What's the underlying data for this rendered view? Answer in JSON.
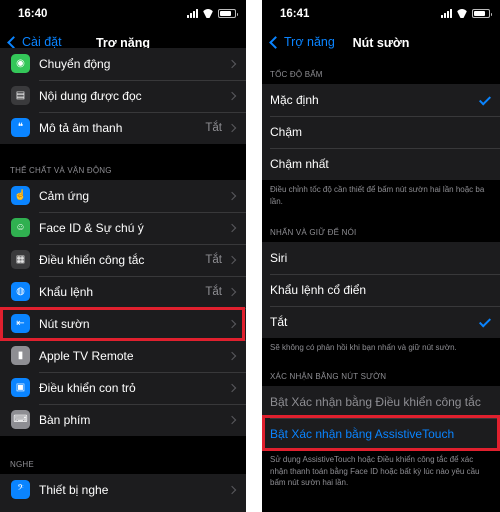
{
  "left": {
    "status": {
      "time": "16:40"
    },
    "nav": {
      "back_label": "Cài đặt",
      "title": "Trợ năng"
    },
    "top_rows": [
      {
        "label": "Chuyển động",
        "value": "",
        "icon": "motion-icon",
        "color": "#34c759"
      },
      {
        "label": "Nội dung được đọc",
        "value": "",
        "icon": "spoken-content-icon",
        "color": "#3a3a3c"
      },
      {
        "label": "Mô tả âm thanh",
        "value": "Tắt",
        "icon": "audio-descriptions-icon",
        "color": "#0a84ff"
      }
    ],
    "section_physical": "THỂ CHẤT VÀ VẬN ĐỘNG",
    "physical_rows": [
      {
        "label": "Cảm ứng",
        "value": "",
        "icon": "touch-icon",
        "color": "#0a84ff"
      },
      {
        "label": "Face ID & Sự chú ý",
        "value": "",
        "icon": "face-id-icon",
        "color": "#30b050"
      },
      {
        "label": "Điều khiển công tắc",
        "value": "Tắt",
        "icon": "switch-control-icon",
        "color": "#3a3a3c"
      },
      {
        "label": "Khẩu lệnh",
        "value": "Tắt",
        "icon": "voice-control-icon",
        "color": "#0a84ff"
      },
      {
        "label": "Nút sườn",
        "value": "",
        "icon": "side-button-icon",
        "color": "#0a84ff"
      },
      {
        "label": "Apple TV Remote",
        "value": "",
        "icon": "apple-tv-remote-icon",
        "color": "#8e8e93"
      },
      {
        "label": "Điều khiển con trỏ",
        "value": "",
        "icon": "pointer-control-icon",
        "color": "#0a84ff"
      },
      {
        "label": "Bàn phím",
        "value": "",
        "icon": "keyboard-icon",
        "color": "#8e8e93"
      }
    ],
    "section_hearing": "NGHE",
    "hearing_rows": [
      {
        "label": "Thiết bị nghe",
        "value": "",
        "icon": "hearing-devices-icon",
        "color": "#0a84ff"
      }
    ]
  },
  "right": {
    "status": {
      "time": "16:41"
    },
    "nav": {
      "back_label": "Trợ năng",
      "title": "Nút sườn"
    },
    "section_click_speed": "TỐC ĐỘ BẤM",
    "speed_rows": [
      {
        "label": "Mặc định",
        "checked": true
      },
      {
        "label": "Chậm",
        "checked": false
      },
      {
        "label": "Chậm nhất",
        "checked": false
      }
    ],
    "speed_footer": "Điều chỉnh tốc độ cần thiết để bấm nút sườn hai lần hoặc ba lần.",
    "section_press_hold": "NHẤN VÀ GIỮ ĐỂ NÓI",
    "hold_rows": [
      {
        "label": "Siri",
        "checked": false
      },
      {
        "label": "Khẩu lệnh cổ điển",
        "checked": false
      },
      {
        "label": "Tắt",
        "checked": true
      }
    ],
    "hold_footer": "Sẽ không có phản hồi khi bạn nhấn và giữ nút sườn.",
    "section_confirm": "XÁC NHẬN BẰNG NÚT SƯỜN",
    "confirm_rows": [
      {
        "label": "Bật Xác nhận bằng Điều khiển công tắc"
      },
      {
        "label": "Bật Xác nhận bằng AssistiveTouch"
      }
    ],
    "confirm_footer": "Sử dụng AssistiveTouch hoặc Điều khiển công tắc để xác nhận thanh toán bằng Face ID hoặc bất kỳ lúc nào yêu cầu bấm nút sườn hai lần."
  },
  "accent_color": "#0a84ff",
  "highlight_color": "#e0202e"
}
